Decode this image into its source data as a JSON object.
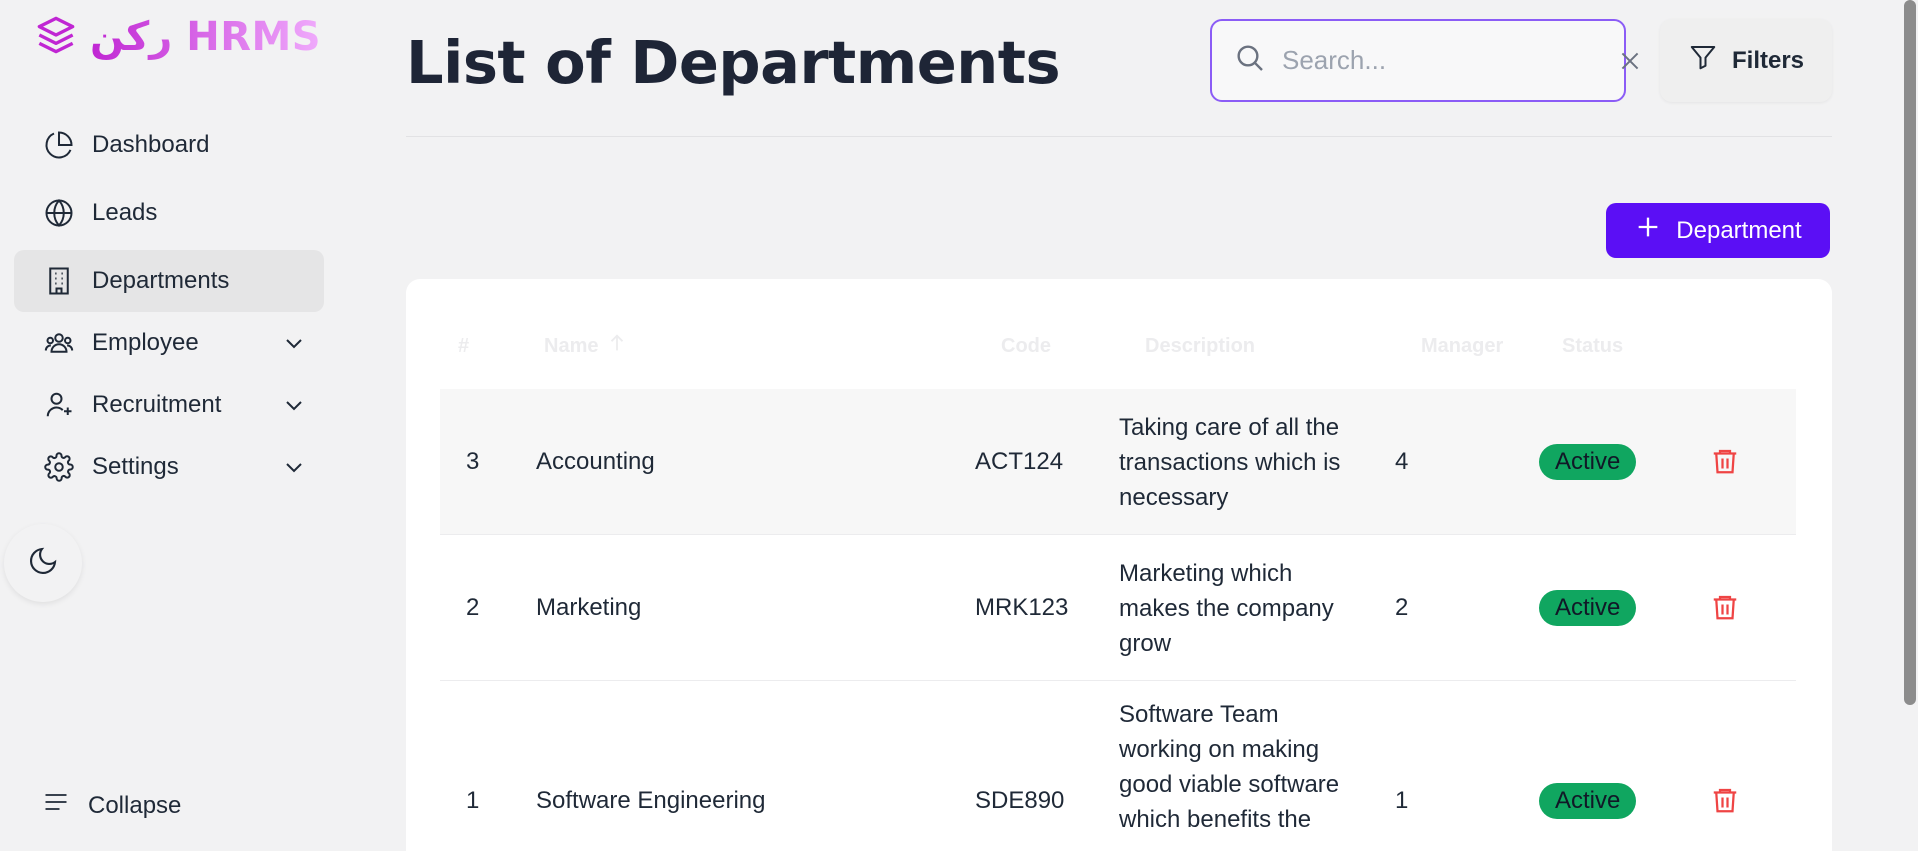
{
  "app": {
    "logo_text": "ركن HRMS"
  },
  "sidebar": {
    "items": [
      {
        "label": "Dashboard",
        "icon": "pie-chart-icon"
      },
      {
        "label": "Leads",
        "icon": "globe-icon"
      },
      {
        "label": "Departments",
        "icon": "building-icon",
        "active": true
      },
      {
        "label": "Employee",
        "icon": "users-icon",
        "expandable": true
      },
      {
        "label": "Recruitment",
        "icon": "user-plus-icon",
        "expandable": true
      },
      {
        "label": "Settings",
        "icon": "gear-icon",
        "expandable": true
      }
    ],
    "theme_toggle_icon": "moon-icon",
    "collapse_label": "Collapse"
  },
  "header": {
    "title": "List of Departments",
    "search_placeholder": "Search...",
    "filters_label": "Filters"
  },
  "toolbar": {
    "add_label": "Department"
  },
  "table": {
    "columns": [
      "#",
      "Name",
      "Code",
      "Description",
      "Manager",
      "Status"
    ],
    "sort_column": "Name",
    "sort_direction": "ascending",
    "rows": [
      {
        "id": "3",
        "name": "Accounting",
        "code": "ACT124",
        "description": "Taking care of all the transactions which is necessary",
        "manager": "4",
        "status": "Active"
      },
      {
        "id": "2",
        "name": "Marketing",
        "code": "MRK123",
        "description": "Marketing which makes the company grow",
        "manager": "2",
        "status": "Active"
      },
      {
        "id": "1",
        "name": "Software Engineering",
        "code": "SDE890",
        "description": "Software Team working on making good viable software which benefits the",
        "manager": "1",
        "status": "Active"
      }
    ]
  },
  "colors": {
    "accent": "#5b0ff5",
    "status_active": "#10a660",
    "delete": "#ef4444",
    "search_border": "#8b5cf6"
  }
}
